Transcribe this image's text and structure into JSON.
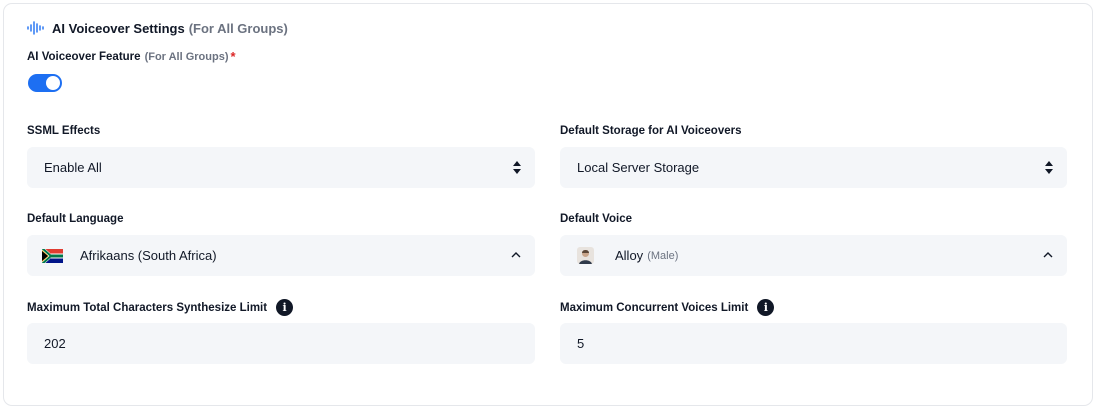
{
  "header": {
    "title": "AI Voiceover Settings",
    "title_suffix": "(For All Groups)",
    "icon": "audio-wave-icon"
  },
  "feature": {
    "label": "AI Voiceover Feature",
    "suffix": "(For All Groups)",
    "required_mark": "*",
    "enabled": true
  },
  "ssml": {
    "label": "SSML Effects",
    "value": "Enable All"
  },
  "storage": {
    "label": "Default Storage for AI Voiceovers",
    "value": "Local Server Storage"
  },
  "language": {
    "label": "Default Language",
    "value": "Afrikaans (South Africa)",
    "icon": "south-africa-flag-icon"
  },
  "voice": {
    "label": "Default Voice",
    "value": "Alloy",
    "gender": "(Male)"
  },
  "chars_limit": {
    "label": "Maximum Total Characters Synthesize Limit",
    "value": "202"
  },
  "voices_limit": {
    "label": "Maximum Concurrent Voices Limit",
    "value": "5"
  },
  "colors": {
    "accent": "#1d6ff2",
    "required": "#dc2626",
    "field_bg": "#f4f6f9"
  }
}
